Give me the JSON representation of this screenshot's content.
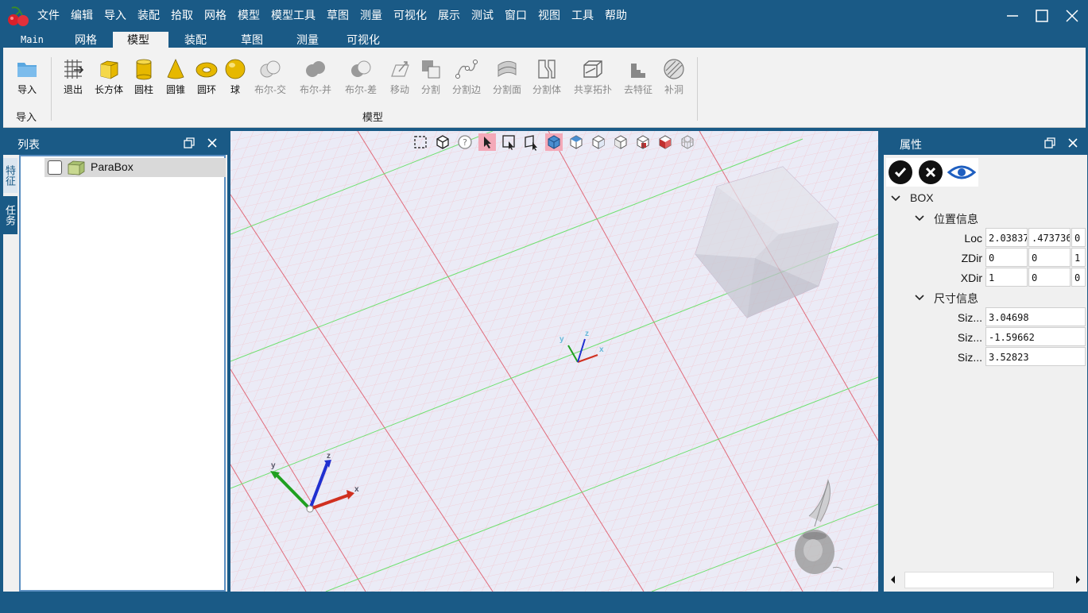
{
  "menubar": {
    "items": [
      "文件",
      "编辑",
      "导入",
      "装配",
      "拾取",
      "网格",
      "模型",
      "模型工具",
      "草图",
      "测量",
      "可视化",
      "展示",
      "测试",
      "窗口",
      "视图",
      "工具",
      "帮助"
    ]
  },
  "ribbon_tabs": [
    {
      "label": "Main"
    },
    {
      "label": "网格"
    },
    {
      "label": "模型"
    },
    {
      "label": "装配"
    },
    {
      "label": "草图"
    },
    {
      "label": "测量"
    },
    {
      "label": "可视化"
    }
  ],
  "ribbon": {
    "import_group": {
      "label": "导入",
      "button": "导入"
    },
    "model_group": {
      "label": "模型",
      "buttons": [
        "退出",
        "长方体",
        "圆柱",
        "圆锥",
        "圆环",
        "球",
        "布尔-交",
        "布尔-并",
        "布尔-差",
        "移动",
        "分割",
        "分割边",
        "分割面",
        "分割体",
        "共享拓扑",
        "去特征",
        "补洞"
      ]
    }
  },
  "left_panel": {
    "title": "列表",
    "side_tabs": [
      "特征",
      "任务"
    ],
    "tree": [
      {
        "label": "ParaBox",
        "checked": false
      }
    ]
  },
  "viewport": {
    "toolbar_icons": [
      "fit-all-icon",
      "view-cube-icon",
      "help-icon",
      "select-pointer-icon",
      "select-box-icon",
      "select-window-icon",
      "shaded-view-icon",
      "top-view-icon",
      "front-view-icon",
      "side-view-icon",
      "iso-view-icon",
      "red-iso-view-icon",
      "wire-view-icon"
    ],
    "axis_labels": {
      "x": "x",
      "y": "y",
      "z": "z"
    }
  },
  "right_panel": {
    "title": "属性",
    "root": "BOX",
    "sections": [
      {
        "title": "位置信息",
        "rows": [
          {
            "key": "Loc",
            "values": [
              "2.03837",
              ".473736",
              "0"
            ]
          },
          {
            "key": "ZDir",
            "values": [
              "0",
              "0",
              "1"
            ]
          },
          {
            "key": "XDir",
            "values": [
              "1",
              "0",
              "0"
            ]
          }
        ]
      },
      {
        "title": "尺寸信息",
        "rows": [
          {
            "key": "Siz...",
            "values": [
              "3.04698"
            ]
          },
          {
            "key": "Siz...",
            "values": [
              "-1.59662"
            ]
          },
          {
            "key": "Siz...",
            "values": [
              "3.52823"
            ]
          }
        ]
      }
    ]
  },
  "colors": {
    "titlebar": "#1a5a86",
    "ribbon_bg": "#f2f2f2",
    "grid_minor": "#f3c3cb",
    "grid_major_red": "#e06b7a",
    "grid_major_green": "#6fe06f",
    "axis_x": "#d03020",
    "axis_y": "#20a020",
    "axis_z": "#2030d0"
  }
}
